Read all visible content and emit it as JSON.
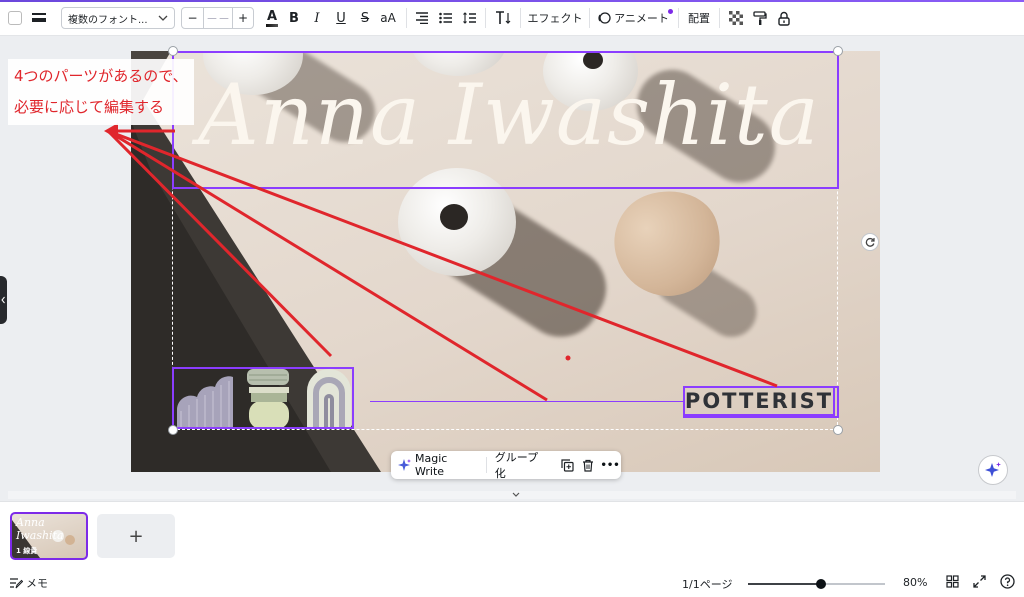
{
  "toolbar": {
    "font_select": "複数のフォント...",
    "size_minus": "−",
    "size_value": "－－",
    "size_plus": "+",
    "text_color_label": "A",
    "bold_label": "B",
    "italic_label": "I",
    "underline_label": "U",
    "strike_label": "S",
    "case_label": "aA",
    "effects_label": "エフェクト",
    "animate_label": "アニメート",
    "position_label": "配置"
  },
  "canvas": {
    "title_text": "Anna Iwashita",
    "tagline": "POTTERIST"
  },
  "annotation": {
    "line1": "4つのパーツがあるので、",
    "line2": "必要に応じて編集する"
  },
  "context_menu": {
    "magic_write_label": "Magic Write",
    "group_label": "グループ化",
    "more_label": "•••"
  },
  "pages": {
    "thumb_title": "Anna Iwashita",
    "thumb_page_num": "1 線貴",
    "add_label": "+"
  },
  "status": {
    "notes_label": "メモ",
    "page_counter": "1/1ページ",
    "zoom": "80%",
    "zoom_fraction": 0.53
  },
  "colors": {
    "selection": "#8b3dff",
    "annotation_red": "#e0262c",
    "accent_purple": "#7d2ae8"
  }
}
